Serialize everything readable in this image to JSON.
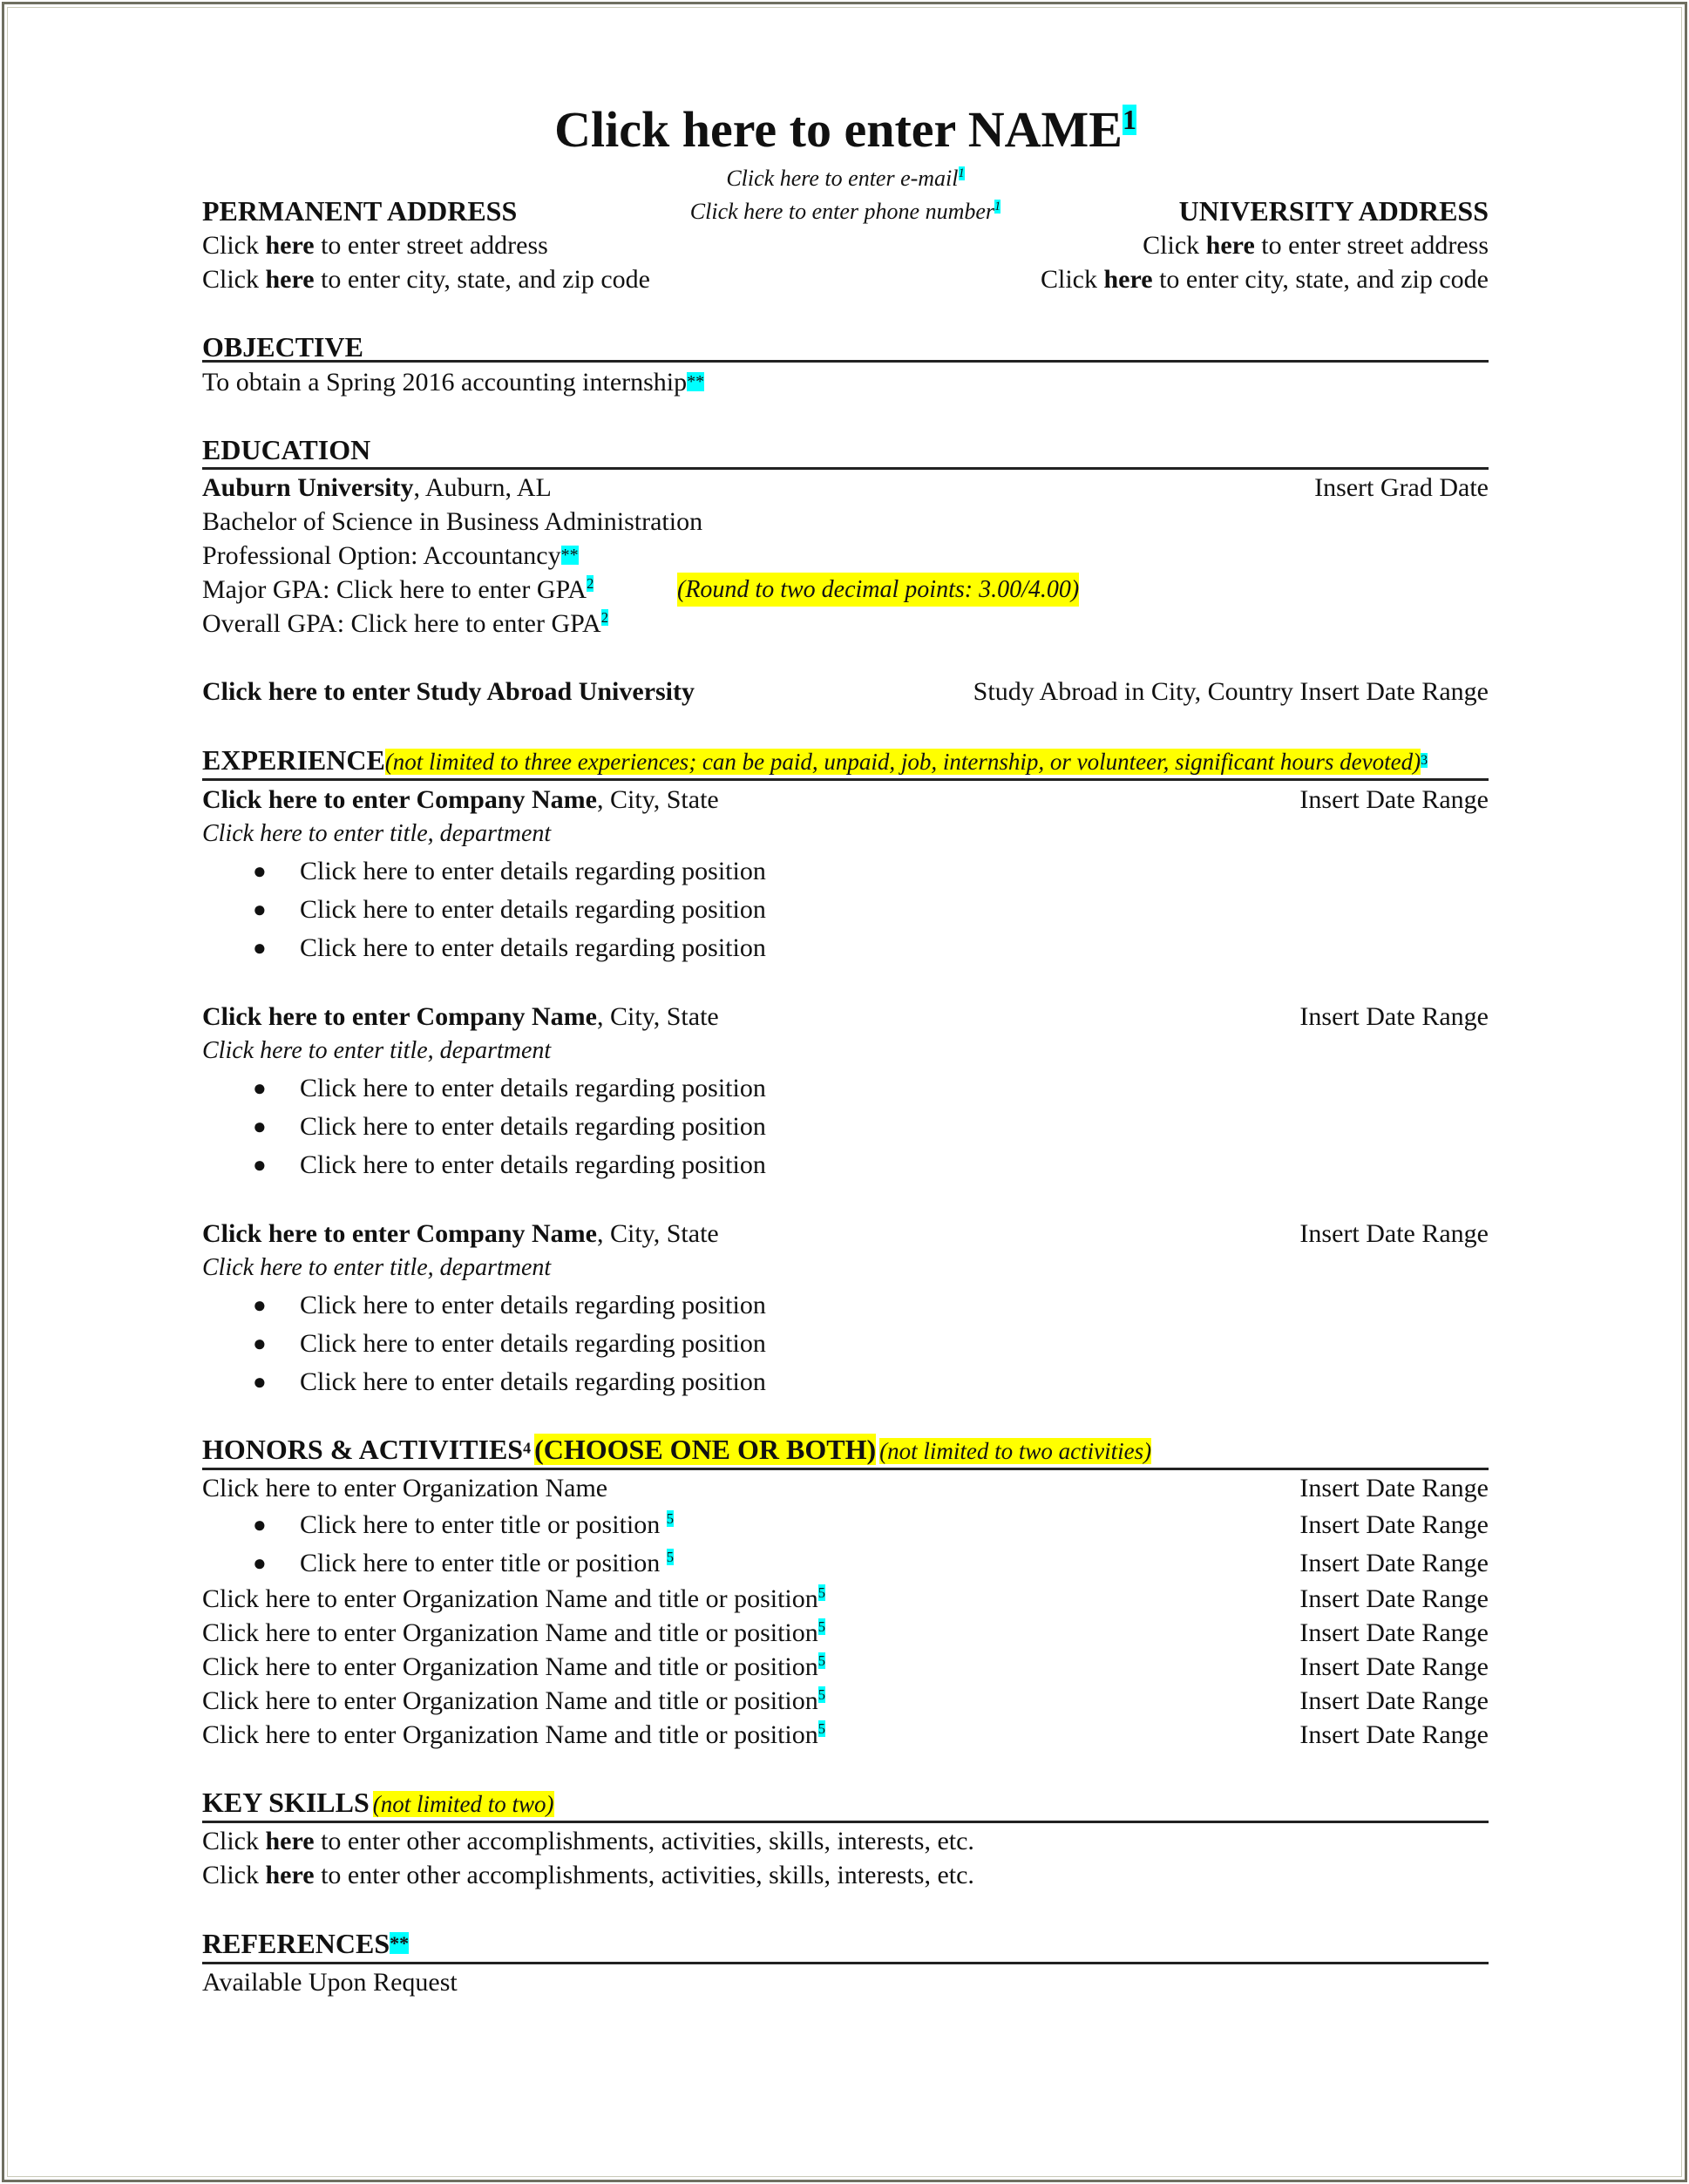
{
  "header": {
    "name": "Click here to enter NAME",
    "name_note": "1",
    "email": "Click here to enter e-mail",
    "email_note": "1",
    "phone": "Click here to enter phone number",
    "phone_note": "1",
    "permanent_address": {
      "heading": "PERMANENT ADDRESS",
      "street_pre": "Click ",
      "street_bold": "here",
      "street_post": " to enter street address",
      "city_pre": "Click ",
      "city_bold": "here",
      "city_post": " to enter city, state, and zip code"
    },
    "university_address": {
      "heading": "UNIVERSITY ADDRESS",
      "street_pre": "Click ",
      "street_bold": "here",
      "street_post": " to enter street address",
      "city_pre": "Click ",
      "city_bold": "here",
      "city_post": " to enter city, state, and zip code"
    }
  },
  "objective": {
    "heading": "OBJECTIVE",
    "text": "To obtain a Spring 2016 accounting internship",
    "note": "**"
  },
  "education": {
    "heading": "EDUCATION",
    "school": "Auburn University",
    "location": ", Auburn, AL",
    "grad_date": "Insert Grad Date",
    "degree": "Bachelor of Science in Business Administration",
    "option": "Professional Option: Accountancy",
    "option_note": "**",
    "major_gpa": "Major GPA: Click here to enter GPA",
    "major_gpa_note": "2",
    "gpa_hint": "(Round to two decimal points: 3.00/4.00)",
    "overall_gpa": "Overall GPA: Click here to enter GPA",
    "overall_gpa_note": "2",
    "study_abroad": "Click here to enter Study Abroad University",
    "study_abroad_right": "Study Abroad in City, Country Insert Date Range"
  },
  "experience": {
    "heading": "EXPERIENCE",
    "hint": "(not limited to three experiences; can be paid, unpaid, job, internship, or volunteer, significant hours devoted)",
    "note": "3",
    "entries": [
      {
        "company": "Click here to enter Company Name",
        "location": ", City, State",
        "date": "Insert Date Range",
        "title": "Click here to enter title, department",
        "bullets": [
          "Click here to enter details regarding position",
          "Click here to enter details regarding position",
          "Click here to enter details regarding position"
        ]
      },
      {
        "company": "Click here to enter Company Name",
        "location": ", City, State",
        "date": "Insert Date Range",
        "title": "Click here to enter title, department",
        "bullets": [
          "Click here to enter details regarding position",
          "Click here to enter details regarding position",
          "Click here to enter details regarding position"
        ]
      },
      {
        "company": "Click here to enter Company Name",
        "location": ", City, State",
        "date": "Insert Date Range",
        "title": "Click here to enter title, department",
        "bullets": [
          "Click here to enter details regarding position",
          "Click here to enter details regarding position",
          "Click here to enter details regarding position"
        ]
      }
    ]
  },
  "honors": {
    "heading": "HONORS & ACTIVITIES",
    "heading_note": "4",
    "choose": "(CHOOSE ONE OR BOTH)",
    "hint": "(not limited to two activities)",
    "org_name": "Click here to enter Organization Name",
    "org_date": "Insert Date Range",
    "positions": [
      {
        "text": "Click here to enter title or position ",
        "note": "5",
        "date": "Insert Date Range"
      },
      {
        "text": "Click here to enter title or position ",
        "note": "5",
        "date": "Insert Date Range"
      }
    ],
    "rows": [
      {
        "text": "Click here to enter Organization Name and title or position",
        "note": "5",
        "date": "Insert Date Range"
      },
      {
        "text": "Click here to enter Organization Name and title or position",
        "note": "5",
        "date": "Insert Date Range"
      },
      {
        "text": "Click here to enter Organization Name and title or position",
        "note": "5",
        "date": "Insert Date Range"
      },
      {
        "text": "Click here to enter Organization Name and title or position",
        "note": "5",
        "date": "Insert Date Range"
      },
      {
        "text": "Click here to enter Organization Name and title or position",
        "note": "5",
        "date": "Insert Date Range"
      }
    ]
  },
  "skills": {
    "heading": "KEY SKILLS",
    "hint": "(not limited to two)",
    "lines": [
      {
        "pre": "Click ",
        "bold": "here",
        "post": " to enter other accomplishments, activities, skills, interests, etc."
      },
      {
        "pre": "Click ",
        "bold": "here",
        "post": " to enter other accomplishments, activities, skills, interests, etc."
      }
    ]
  },
  "references": {
    "heading": "REFERENCES",
    "note": "**",
    "text": "Available Upon Request"
  },
  "colors": {
    "highlight_yellow": "#ffff00",
    "highlight_cyan": "#00ffff",
    "frame": "#6f6f60"
  }
}
